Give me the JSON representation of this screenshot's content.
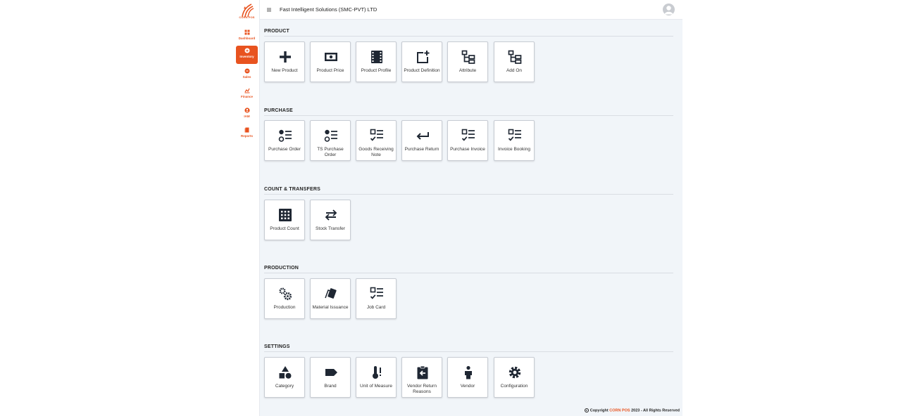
{
  "app": {
    "logo_text": "CORN POS",
    "company_name": "Fast Intelligent Solutions (SMC-PVT) LTD"
  },
  "sidebar": {
    "items": [
      {
        "label": "Dashboard",
        "icon": "dashboard-icon",
        "active": false
      },
      {
        "label": "Inventory",
        "icon": "inventory-icon",
        "active": true
      },
      {
        "label": "Sales",
        "icon": "sales-icon",
        "active": false
      },
      {
        "label": "Finance",
        "icon": "finance-icon",
        "active": false
      },
      {
        "label": "IAM",
        "icon": "user-icon",
        "active": false
      },
      {
        "label": "Reports",
        "icon": "reports-icon",
        "active": false
      }
    ]
  },
  "sections": [
    {
      "title": "PRODUCT",
      "tiles": [
        {
          "label": "New Product",
          "icon": "plus-icon"
        },
        {
          "label": "Product Price",
          "icon": "money-icon"
        },
        {
          "label": "Product Profile",
          "icon": "film-icon"
        },
        {
          "label": "Product Definition",
          "icon": "add-box-icon"
        },
        {
          "label": "Attribute",
          "icon": "tree-icon"
        },
        {
          "label": "Add On",
          "icon": "tree-icon"
        }
      ]
    },
    {
      "title": "PURCHASE",
      "tiles": [
        {
          "label": "Purchase Order",
          "icon": "list-circle-icon"
        },
        {
          "label": "TS Purchase Order",
          "icon": "list-circle-icon"
        },
        {
          "label": "Goods Receiving Note",
          "icon": "checklist-icon"
        },
        {
          "label": "Purchase Return",
          "icon": "return-arrow-icon"
        },
        {
          "label": "Purchase Invoice",
          "icon": "checklist-icon"
        },
        {
          "label": "Invoice Booking",
          "icon": "checklist-icon"
        }
      ]
    },
    {
      "title": "COUNT & TRANSFERS",
      "tiles": [
        {
          "label": "Product Count",
          "icon": "grid-icon"
        },
        {
          "label": "Stock Transfer",
          "icon": "swap-icon"
        }
      ]
    },
    {
      "title": "PRODUCTION",
      "tiles": [
        {
          "label": "Production",
          "icon": "gears-icon"
        },
        {
          "label": "Material Issuance",
          "icon": "cards-icon"
        },
        {
          "label": "Job Card",
          "icon": "checklist-icon"
        }
      ]
    },
    {
      "title": "SETTINGS",
      "tiles": [
        {
          "label": "Category",
          "icon": "shapes-icon"
        },
        {
          "label": "Brand",
          "icon": "tag-icon"
        },
        {
          "label": "Unit of Measure",
          "icon": "thermometer-icon"
        },
        {
          "label": "Vendor Return Reasons",
          "icon": "clipboard-return-icon"
        },
        {
          "label": "Vendor",
          "icon": "person-icon"
        },
        {
          "label": "Configuration",
          "icon": "gear-icon"
        }
      ]
    }
  ],
  "footer": {
    "prefix": "Copyright",
    "brand": "CORN POS",
    "suffix": "2023 - All Rights Reserved"
  },
  "colors": {
    "accent": "#e8531f",
    "background": "#f1f5f9",
    "icon": "#1f2733"
  }
}
